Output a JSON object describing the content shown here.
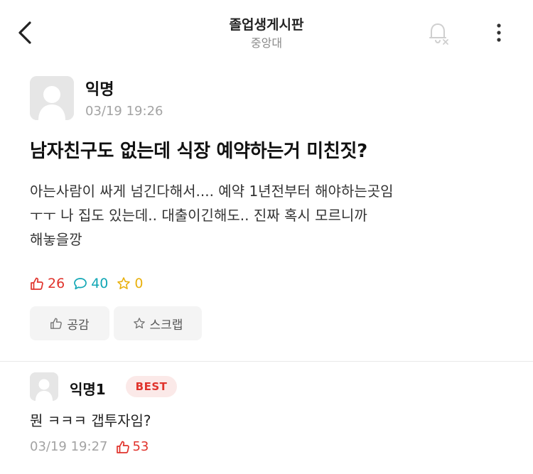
{
  "header": {
    "board_title": "졸업생게시판",
    "school_name": "중앙대",
    "back_icon": "chevron-left-icon",
    "bell_icon": "bell-off-icon",
    "more_icon": "more-vertical-icon"
  },
  "post": {
    "author": "익명",
    "time": "03/19 19:26",
    "title": "남자친구도 없는데 식장 예약하는거 미친짓?",
    "body_lines": [
      "아는사람이 싸게 넘긴다해서.... 예약 1년전부터 해야하는곳임",
      "ㅜㅜ 나 집도 있는데.. 대출이긴해도.. 진짜 혹시 모르니까",
      "해놓을깡"
    ],
    "like_count": "26",
    "comment_count": "40",
    "scrap_count": "0",
    "like_button_label": "공감",
    "scrap_button_label": "스크랩"
  },
  "comment": {
    "author": "익명1",
    "badge": "BEST",
    "text": "뭔 ㅋㅋㅋ 갭투자임?",
    "time": "03/19 19:27",
    "like_count": "53"
  },
  "colors": {
    "like_red": "#e0332c",
    "comment_teal": "#12a7b5",
    "scrap_yellow": "#e9b10f",
    "meta_gray": "#a3a3a3"
  }
}
